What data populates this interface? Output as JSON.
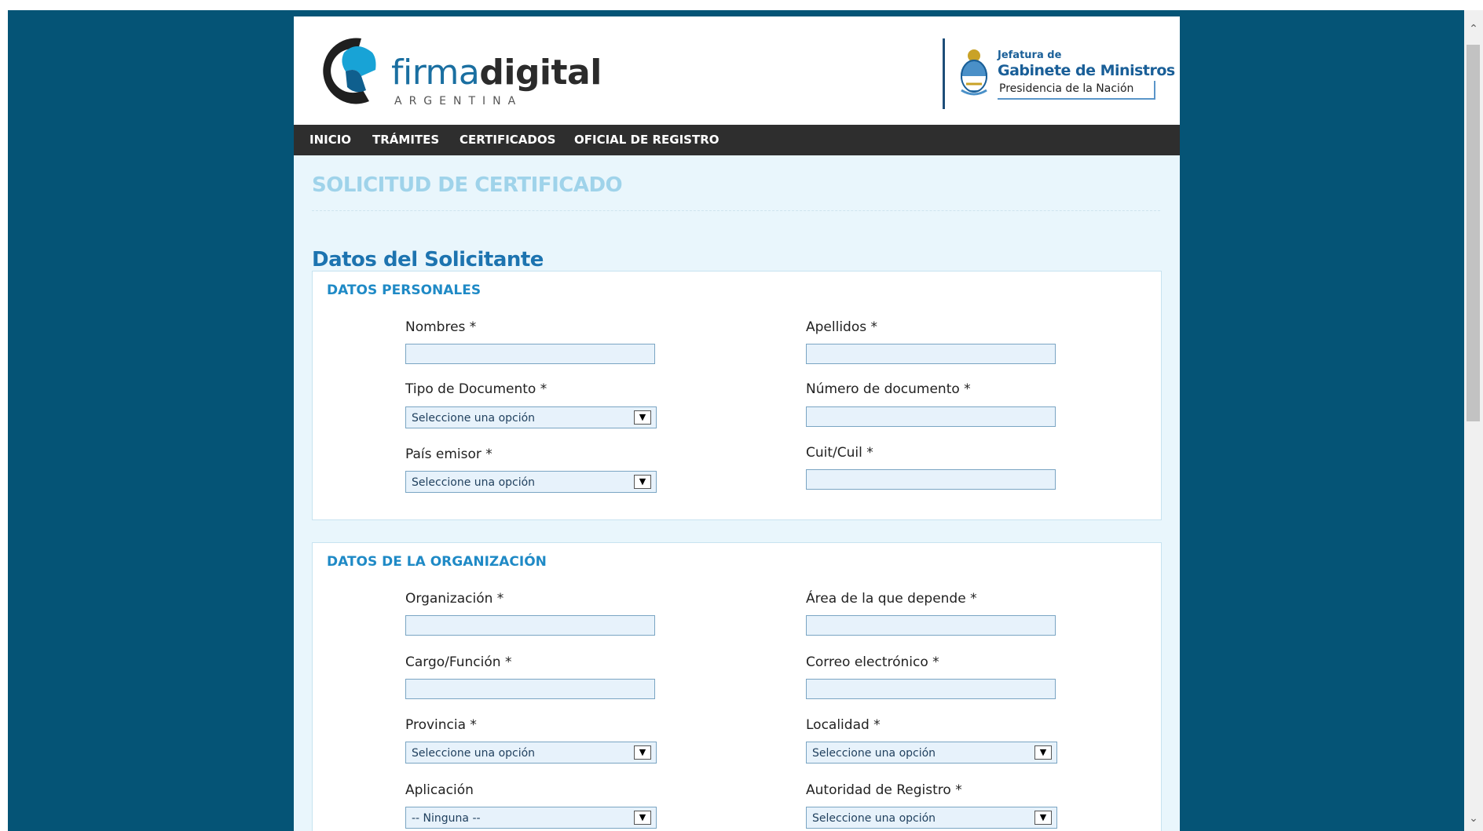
{
  "header": {
    "logo_light": "firma",
    "logo_bold": "digital",
    "logo_sub": "ARGENTINA",
    "gov_line1": "Jefatura de",
    "gov_line2": "Gabinete de Ministros",
    "gov_line3": "Presidencia de la Nación"
  },
  "nav": {
    "items": [
      "INICIO",
      "TRÁMITES",
      "CERTIFICADOS",
      "OFICIAL DE REGISTRO"
    ]
  },
  "page": {
    "title": "SOLICITUD DE CERTIFICADO",
    "section_heading": "Datos del Solicitante"
  },
  "personal": {
    "title": "DATOS PERSONALES",
    "nombres_label": "Nombres *",
    "apellidos_label": "Apellidos *",
    "tipo_doc_label": "Tipo de Documento *",
    "tipo_doc_value": "Seleccione una opción",
    "num_doc_label": "Número de documento *",
    "pais_label": "País emisor *",
    "pais_value": "Seleccione una opción",
    "cuit_label": "Cuit/Cuil *"
  },
  "organization": {
    "title": "DATOS DE LA ORGANIZACIÓN",
    "org_label": "Organización *",
    "area_label": "Área de la que depende *",
    "cargo_label": "Cargo/Función *",
    "correo_label": "Correo electrónico *",
    "provincia_label": "Provincia *",
    "provincia_value": "Seleccione una opción",
    "localidad_label": "Localidad *",
    "localidad_value": "Seleccione una opción",
    "aplicacion_label": "Aplicación",
    "aplicacion_value": "-- Ninguna --",
    "autoridad_label": "Autoridad de Registro *",
    "autoridad_value": "Seleccione una opción"
  },
  "colors": {
    "background": "#055476",
    "nav_bg": "#2e2e2e",
    "section_title": "#1f8ac6",
    "page_title": "#9fd3ea"
  },
  "icons": {
    "logo": "firmadigital-logo-icon",
    "emblem": "argentina-coat-of-arms-icon",
    "dropdown": "dropdown-arrow-icon"
  }
}
